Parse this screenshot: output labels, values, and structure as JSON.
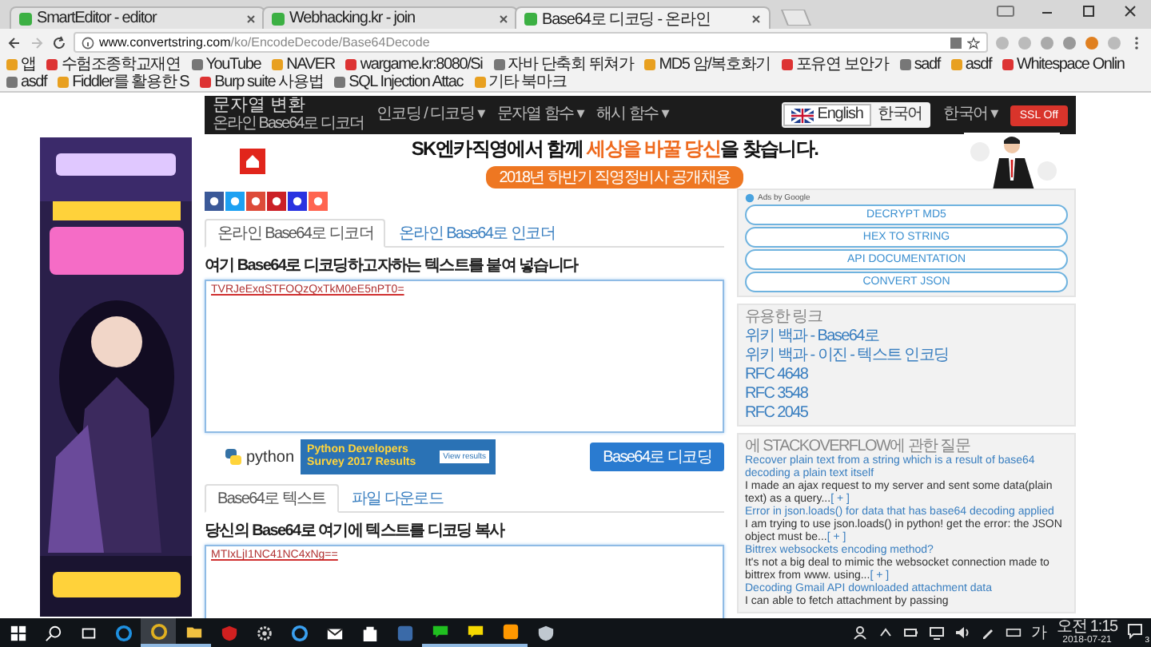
{
  "browser": {
    "tabs": [
      {
        "title": "SmartEditor - editor",
        "selected": false
      },
      {
        "title": "Webhacking.kr - join",
        "selected": false
      },
      {
        "title": "Base64로 디코딩 - 온라인",
        "selected": true
      }
    ],
    "address": {
      "host": "www.convertstring.com",
      "path": "/ko/EncodeDecode/Base64Decode"
    },
    "bookmarks": [
      "앱",
      "수험조종학교재연",
      "YouTube",
      "NAVER",
      "wargame.kr:8080/Si",
      "자바 단축회 뛰쳐가",
      "MD5 암/복호화기",
      "포유연 보안가",
      "sadf",
      "asdf",
      "Whitespace Onlin",
      "asdf",
      "Fiddler를 활용한 S",
      "Burp suite 사용법",
      "SQL Injection Attac",
      "기타 북마크"
    ]
  },
  "header": {
    "logo": "문자열 변환",
    "subtitle": "온라인 Base64로 디코더",
    "menus": [
      "인코딩 / 디코딩 ▾",
      "문자열 함수 ▾",
      "해시 함수 ▾"
    ],
    "languages": [
      {
        "label": "English",
        "selected": true
      },
      {
        "label": "한국어",
        "selected": false
      }
    ],
    "language_menu": "한국어 ▾",
    "ssl_button": "SSL Off"
  },
  "banner": {
    "headline": [
      {
        "text": "SK엔카직영에서 함께 ",
        "highlight": false
      },
      {
        "text": "세상을 바꿀 당신",
        "highlight": true
      },
      {
        "text": "을 찾습니다.",
        "highlight": false
      }
    ],
    "button": "2018년 하반기 직영정비사 공개채용"
  },
  "mode_tabs": [
    {
      "label": "온라인 Base64로 디코더",
      "selected": true
    },
    {
      "label": "온라인 Base64로 인코더",
      "selected": false
    }
  ],
  "input": {
    "heading": "여기 Base64로 디코딩하고자하는 텍스트를 붙여 넣습니다",
    "value": "TVRJeExqSTFOQzQxTkM0eE5nPT0="
  },
  "python_ad": {
    "logo": "python",
    "title": "Python Developers Survey 2017 Results",
    "button": "View results"
  },
  "decode_button": "Base64로 디코딩",
  "output_tabs": [
    {
      "label": "Base64로 텍스트",
      "selected": true
    },
    {
      "label": "파일 다운로드",
      "selected": false
    }
  ],
  "output": {
    "heading": "당신의 Base64로 여기에 텍스트를 디코딩 복사",
    "value": "MTIxLjI1NC41NC4xNg=="
  },
  "sidebar": {
    "ads_label": "Ads by Google",
    "ad_links": [
      "DECRYPT MD5",
      "HEX TO STRING",
      "API DOCUMENTATION",
      "CONVERT JSON"
    ],
    "links_title": "유용한 링크",
    "links": [
      "위키 백과 - Base64로",
      "위키 백과 - 이진 - 텍스트 인코딩",
      "RFC 4648",
      "RFC 3548",
      "RFC 2045"
    ],
    "questions_title": "에 STACKOVERFLOW에 관한 질문",
    "questions": [
      {
        "title": "Recover plain text from a string which is a result of base64 decoding a plain text itself",
        "excerpt": "I made an ajax request to my server and sent some data(plain text) as a query...",
        "more": "[ + ]"
      },
      {
        "title": "Error in json.loads() for data that has base64 decoding applied",
        "excerpt": "I am trying to use json.loads() in python! get the error: the JSON object must be...",
        "more": "[ + ]"
      },
      {
        "title": "Bittrex websockets encoding method?",
        "excerpt": "It's not a big deal to mimic the websocket connection made to bittrex from www. using...",
        "more": "[ + ]"
      },
      {
        "title": "Decoding Gmail API downloaded attachment data",
        "excerpt": "I can able to fetch attachment by passing"
      }
    ]
  },
  "taskbar": {
    "apps": [
      {
        "kind": "start",
        "running": false,
        "active": false
      },
      {
        "kind": "search",
        "running": false,
        "active": false
      },
      {
        "kind": "taskview",
        "running": false,
        "active": false
      },
      {
        "kind": "edge",
        "running": false,
        "active": false
      },
      {
        "kind": "chrome",
        "running": true,
        "active": true
      },
      {
        "kind": "folder",
        "running": true,
        "active": false
      },
      {
        "kind": "antivirus",
        "running": false,
        "active": false
      },
      {
        "kind": "settings",
        "running": false,
        "active": false
      },
      {
        "kind": "ie",
        "running": false,
        "active": false
      },
      {
        "kind": "mail",
        "running": false,
        "active": false
      },
      {
        "kind": "store",
        "running": false,
        "active": false
      },
      {
        "kind": "steam",
        "running": false,
        "active": false
      },
      {
        "kind": "line",
        "running": true,
        "active": false
      },
      {
        "kind": "kakao",
        "running": true,
        "active": false
      },
      {
        "kind": "sublime",
        "running": true,
        "active": false
      },
      {
        "kind": "security",
        "running": false,
        "active": false
      }
    ],
    "ime": "가",
    "time": "오전 1:15",
    "date": "2018-07-21",
    "notifications": "3"
  }
}
